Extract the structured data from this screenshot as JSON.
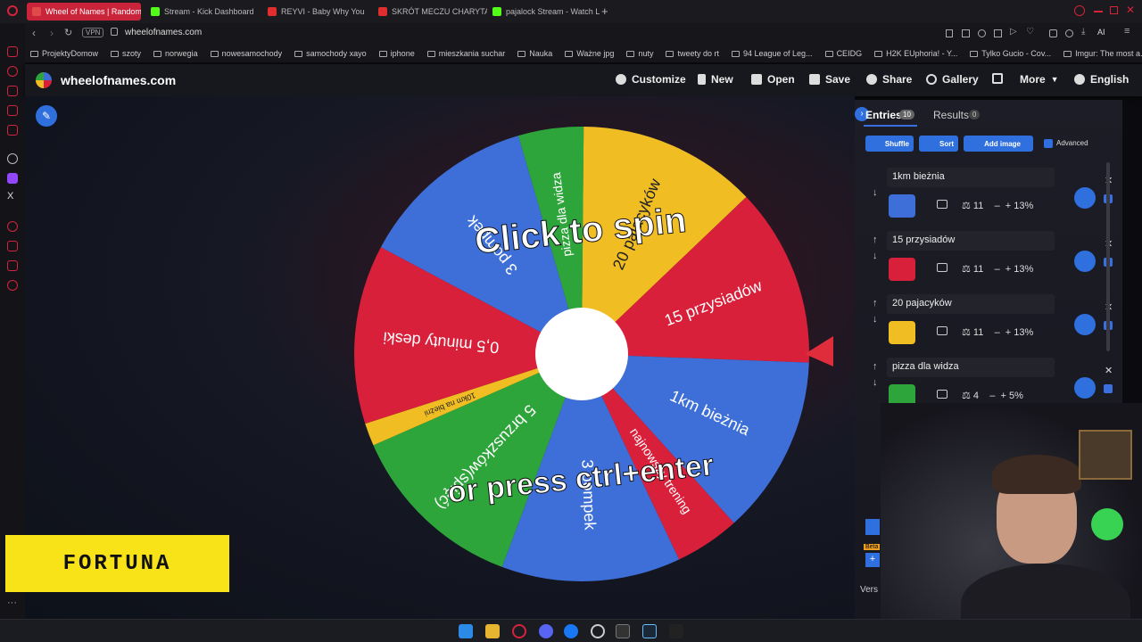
{
  "browser": {
    "tabs": [
      {
        "label": "Wheel of Names | Random",
        "color": "#e04a4a",
        "active": true
      },
      {
        "label": "Stream - Kick Dashboard",
        "color": "#53fc18",
        "active": false
      },
      {
        "label": "REYVI - Baby Why You",
        "color": "#e02d2d",
        "active": false
      },
      {
        "label": "SKRÓT MECZU CHARYTA",
        "color": "#e02d2d",
        "active": false
      },
      {
        "label": "pajalock Stream - Watch L",
        "color": "#53fc18",
        "active": false
      }
    ],
    "url": "wheelofnames.com",
    "vpn_label": "VPN",
    "ai_label": "AI",
    "bookmarks": [
      "ProjektyDomow",
      "szoty",
      "norwegia",
      "nowesamochody",
      "samochody xayo",
      "iphone",
      "mieszkania suchar",
      "Nauka",
      "Ważne jpg",
      "nuty",
      "tweety do rt",
      "94 League of Leg...",
      "CEIDG",
      "H2K EUphoria! - Y...",
      "Tylko Gucio - Cov...",
      "Imgur: The most a..."
    ]
  },
  "site": {
    "logo_text": "wheelofnames.com",
    "menu": {
      "customize": "Customize",
      "new": "New",
      "open": "Open",
      "save": "Save",
      "share": "Share",
      "gallery": "Gallery",
      "more": "More",
      "language": "English"
    }
  },
  "wheel": {
    "center_text_top": "Click to spin",
    "center_text_bottom": "or press ctrl+enter",
    "segments": [
      {
        "label": "3 pompek",
        "color": "#3e6fd8",
        "weight": 11
      },
      {
        "label": "pizza dla widza",
        "color": "#2ea53a",
        "weight": 4
      },
      {
        "label": "20 pajacyków",
        "color": "#f0bd22",
        "weight": 11
      },
      {
        "label": "15 przysiadów",
        "color": "#d8203a",
        "weight": 11
      },
      {
        "label": "1km bieżnia",
        "color": "#3e6fd8",
        "weight": 11
      },
      {
        "label": "najnowszy trening",
        "color": "#d8203a",
        "weight": 4
      },
      {
        "label": "3 pompek",
        "color": "#3e6fd8",
        "weight": 11
      },
      {
        "label": "5 brzuszków(spięć)",
        "color": "#2ea53a",
        "weight": 11
      },
      {
        "label": "10km na bieżni",
        "color": "#f0bd22",
        "weight": 1.4
      },
      {
        "label": "0,5 minuty deski",
        "color": "#d8203a",
        "weight": 11
      }
    ]
  },
  "panel": {
    "entries_tab": "Entries",
    "entries_count": "10",
    "results_tab": "Results",
    "results_count": "0",
    "shuffle": "Shuffle",
    "sort": "Sort",
    "add_image": "Add image",
    "advanced": "Advanced",
    "entries": [
      {
        "title": "1km bieżnia",
        "color": "#3e6fd8",
        "weight": "11",
        "percent": "13%"
      },
      {
        "title": "15 przysiadów",
        "color": "#d8203a",
        "weight": "11",
        "percent": "13%"
      },
      {
        "title": "20 pajacyków",
        "color": "#f0bd22",
        "weight": "11",
        "percent": "13%"
      },
      {
        "title": "pizza dla widza",
        "color": "#2ea53a",
        "weight": "4",
        "percent": "5%"
      }
    ],
    "version_label": "Vers",
    "beta_label": "Beta"
  },
  "ad": {
    "brand": "FORTUNA"
  }
}
